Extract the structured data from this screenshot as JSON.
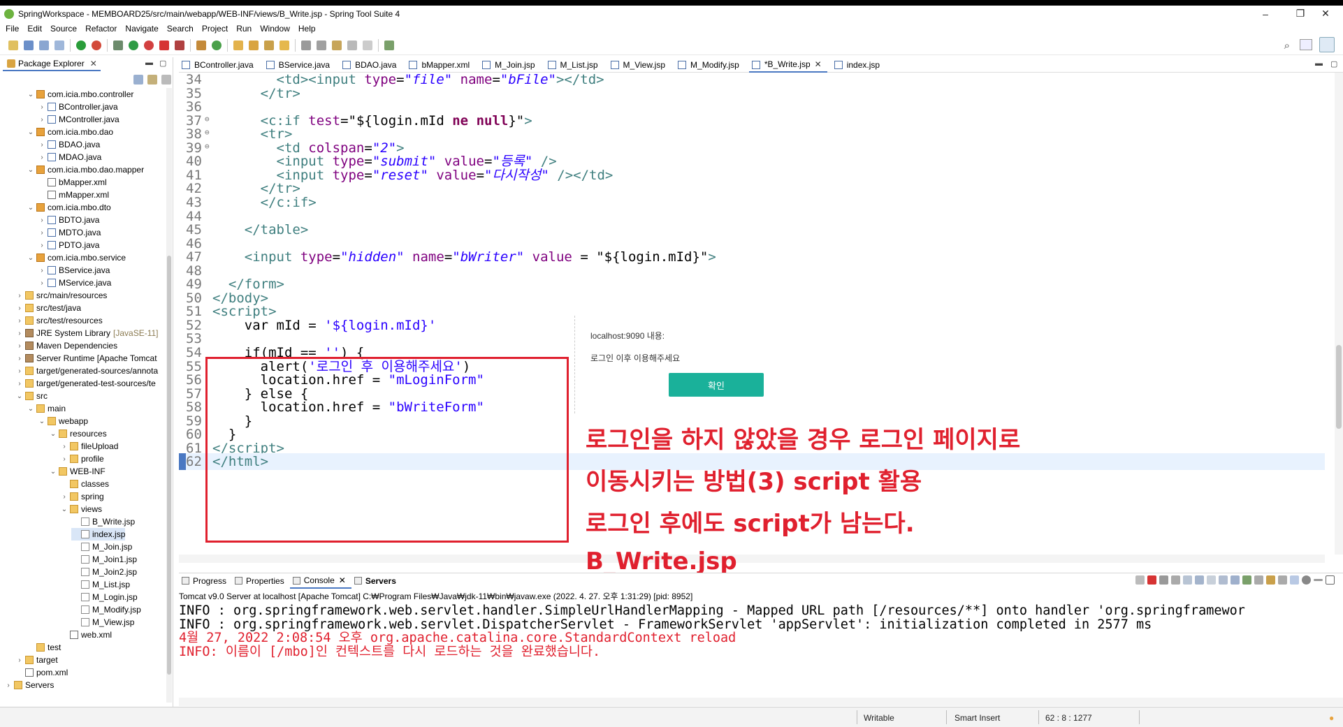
{
  "window": {
    "title": "SpringWorkspace - MEMBOARD25/src/main/webapp/WEB-INF/views/B_Write.jsp - Spring Tool Suite 4",
    "minimize": "–",
    "maximize": "❐",
    "close": "✕"
  },
  "menu": [
    "File",
    "Edit",
    "Source",
    "Refactor",
    "Navigate",
    "Search",
    "Project",
    "Run",
    "Window",
    "Help"
  ],
  "package_explorer": {
    "title": "Package Explorer",
    "close": "✕",
    "tree": [
      {
        "label": "com.icia.mbo.controller",
        "indent": 3,
        "arrow": "v",
        "icon": "pkg"
      },
      {
        "label": "BController.java",
        "indent": 4,
        "arrow": ">",
        "icon": "java"
      },
      {
        "label": "MController.java",
        "indent": 4,
        "arrow": ">",
        "icon": "java"
      },
      {
        "label": "com.icia.mbo.dao",
        "indent": 3,
        "arrow": "v",
        "icon": "pkg"
      },
      {
        "label": "BDAO.java",
        "indent": 4,
        "arrow": ">",
        "icon": "java"
      },
      {
        "label": "MDAO.java",
        "indent": 4,
        "arrow": ">",
        "icon": "java"
      },
      {
        "label": "com.icia.mbo.dao.mapper",
        "indent": 3,
        "arrow": "v",
        "icon": "pkg"
      },
      {
        "label": "bMapper.xml",
        "indent": 4,
        "arrow": "",
        "icon": "xml"
      },
      {
        "label": "mMapper.xml",
        "indent": 4,
        "arrow": "",
        "icon": "xml"
      },
      {
        "label": "com.icia.mbo.dto",
        "indent": 3,
        "arrow": "v",
        "icon": "pkg"
      },
      {
        "label": "BDTO.java",
        "indent": 4,
        "arrow": ">",
        "icon": "java"
      },
      {
        "label": "MDTO.java",
        "indent": 4,
        "arrow": ">",
        "icon": "java"
      },
      {
        "label": "PDTO.java",
        "indent": 4,
        "arrow": ">",
        "icon": "java"
      },
      {
        "label": "com.icia.mbo.service",
        "indent": 3,
        "arrow": "v",
        "icon": "pkg"
      },
      {
        "label": "BService.java",
        "indent": 4,
        "arrow": ">",
        "icon": "java"
      },
      {
        "label": "MService.java",
        "indent": 4,
        "arrow": ">",
        "icon": "java"
      },
      {
        "label": "src/main/resources",
        "indent": 2,
        "arrow": ">",
        "icon": "folder"
      },
      {
        "label": "src/test/java",
        "indent": 2,
        "arrow": ">",
        "icon": "folder"
      },
      {
        "label": "src/test/resources",
        "indent": 2,
        "arrow": ">",
        "icon": "folder"
      },
      {
        "label": "JRE System Library",
        "suffix": "[JavaSE-11]",
        "indent": 2,
        "arrow": ">",
        "icon": "lib"
      },
      {
        "label": "Maven Dependencies",
        "indent": 2,
        "arrow": ">",
        "icon": "lib"
      },
      {
        "label": "Server Runtime [Apache Tomcat",
        "indent": 2,
        "arrow": ">",
        "icon": "lib"
      },
      {
        "label": "target/generated-sources/annota",
        "indent": 2,
        "arrow": ">",
        "icon": "folder"
      },
      {
        "label": "target/generated-test-sources/te",
        "indent": 2,
        "arrow": ">",
        "icon": "folder"
      },
      {
        "label": "src",
        "indent": 2,
        "arrow": "v",
        "icon": "folder"
      },
      {
        "label": "main",
        "indent": 3,
        "arrow": "v",
        "icon": "folder"
      },
      {
        "label": "webapp",
        "indent": 4,
        "arrow": "v",
        "icon": "folder"
      },
      {
        "label": "resources",
        "indent": 5,
        "arrow": "v",
        "icon": "folder"
      },
      {
        "label": "fileUpload",
        "indent": 6,
        "arrow": ">",
        "icon": "folder"
      },
      {
        "label": "profile",
        "indent": 6,
        "arrow": ">",
        "icon": "folder"
      },
      {
        "label": "WEB-INF",
        "indent": 5,
        "arrow": "v",
        "icon": "folder"
      },
      {
        "label": "classes",
        "indent": 6,
        "arrow": "",
        "icon": "folder"
      },
      {
        "label": "spring",
        "indent": 6,
        "arrow": ">",
        "icon": "folder"
      },
      {
        "label": "views",
        "indent": 6,
        "arrow": "v",
        "icon": "folder"
      },
      {
        "label": "B_Write.jsp",
        "indent": 7,
        "arrow": "",
        "icon": "jsp"
      },
      {
        "label": "index.jsp",
        "indent": 7,
        "arrow": "",
        "icon": "jsp",
        "selected": true
      },
      {
        "label": "M_Join.jsp",
        "indent": 7,
        "arrow": "",
        "icon": "jsp"
      },
      {
        "label": "M_Join1.jsp",
        "indent": 7,
        "arrow": "",
        "icon": "jsp"
      },
      {
        "label": "M_Join2.jsp",
        "indent": 7,
        "arrow": "",
        "icon": "jsp"
      },
      {
        "label": "M_List.jsp",
        "indent": 7,
        "arrow": "",
        "icon": "jsp"
      },
      {
        "label": "M_Login.jsp",
        "indent": 7,
        "arrow": "",
        "icon": "jsp"
      },
      {
        "label": "M_Modify.jsp",
        "indent": 7,
        "arrow": "",
        "icon": "jsp"
      },
      {
        "label": "M_View.jsp",
        "indent": 7,
        "arrow": "",
        "icon": "jsp"
      },
      {
        "label": "web.xml",
        "indent": 6,
        "arrow": "",
        "icon": "xml"
      },
      {
        "label": "test",
        "indent": 3,
        "arrow": "",
        "icon": "folder"
      },
      {
        "label": "target",
        "indent": 2,
        "arrow": ">",
        "icon": "folder"
      },
      {
        "label": "pom.xml",
        "indent": 2,
        "arrow": "",
        "icon": "xml"
      },
      {
        "label": "Servers",
        "indent": 1,
        "arrow": ">",
        "icon": "folder"
      }
    ]
  },
  "editor": {
    "tabs": [
      {
        "label": "BController.java"
      },
      {
        "label": "BService.java"
      },
      {
        "label": "BDAO.java"
      },
      {
        "label": "bMapper.xml"
      },
      {
        "label": "M_Join.jsp"
      },
      {
        "label": "M_List.jsp"
      },
      {
        "label": "M_View.jsp"
      },
      {
        "label": "M_Modify.jsp"
      },
      {
        "label": "*B_Write.jsp",
        "active": true,
        "close": "✕"
      },
      {
        "label": "index.jsp"
      }
    ],
    "lines": [
      {
        "n": "34",
        "html": "        <span class='tg'>&lt;td&gt;&lt;input</span> <span class='at'>type</span>=<span class='sv'>\"file\"</span> <span class='at'>name</span>=<span class='sv'>\"bFile\"</span><span class='tg'>&gt;&lt;/td&gt;</span>"
      },
      {
        "n": "35",
        "html": "      <span class='tg'>&lt;/tr&gt;</span>"
      },
      {
        "n": "36",
        "html": ""
      },
      {
        "n": "37",
        "mark": "⊖",
        "html": "      <span class='tg'>&lt;c:if</span> <span class='at'>test</span>=\"${login.mId <span class='kw'>ne</span> <span class='kw'>null</span>}\"<span class='tg'>&gt;</span>"
      },
      {
        "n": "38",
        "mark": "⊖",
        "html": "      <span class='tg'>&lt;tr&gt;</span>"
      },
      {
        "n": "39",
        "mark": "⊖",
        "html": "        <span class='tg'>&lt;td</span> <span class='at'>colspan</span>=<span class='sv'>\"2\"</span><span class='tg'>&gt;</span>"
      },
      {
        "n": "40",
        "html": "        <span class='tg'>&lt;input</span> <span class='at'>type</span>=<span class='sv'>\"submit\"</span> <span class='at'>value</span>=<span class='sv'>\"등록\"</span> <span class='tg'>/&gt;</span>"
      },
      {
        "n": "41",
        "html": "        <span class='tg'>&lt;input</span> <span class='at'>type</span>=<span class='sv'>\"reset\"</span> <span class='at'>value</span>=<span class='sv'>\"다시작성\"</span> <span class='tg'>/&gt;&lt;/td&gt;</span>"
      },
      {
        "n": "42",
        "html": "      <span class='tg'>&lt;/tr&gt;</span>"
      },
      {
        "n": "43",
        "html": "      <span class='tg'>&lt;/c:if&gt;</span>"
      },
      {
        "n": "44",
        "html": ""
      },
      {
        "n": "45",
        "html": "    <span class='tg'>&lt;/table&gt;</span>"
      },
      {
        "n": "46",
        "html": ""
      },
      {
        "n": "47",
        "html": "    <span class='tg'>&lt;input</span> <span class='at'>type</span>=<span class='sv'>\"hidden\"</span> <span class='at'>name</span>=<span class='sv'>\"bWriter\"</span> <span class='at'>value</span> = \"${login.mId}\"<span class='tg'>&gt;</span>"
      },
      {
        "n": "48",
        "html": ""
      },
      {
        "n": "49",
        "html": "  <span class='tg'>&lt;/form&gt;</span>"
      },
      {
        "n": "50",
        "html": "<span class='tg'>&lt;/body&gt;</span>"
      },
      {
        "n": "51",
        "html": "<span class='tg'>&lt;script&gt;</span>"
      },
      {
        "n": "52",
        "html": "    <span class='el'>var mId = </span><span class='str'>'${login.mId}'</span>"
      },
      {
        "n": "53",
        "html": ""
      },
      {
        "n": "54",
        "html": "    <span class='el'>if(mId == </span><span class='str'>''</span><span class='el'>) {</span>"
      },
      {
        "n": "55",
        "html": "      <span class='el'>alert(</span><span class='str'>'로그인 후 이용해주세요'</span><span class='el'>)</span>"
      },
      {
        "n": "56",
        "html": "      <span class='el'>location.href = </span><span class='str'>\"mLoginForm\"</span>"
      },
      {
        "n": "57",
        "html": "    <span class='el'>} else {</span>"
      },
      {
        "n": "58",
        "html": "      <span class='el'>location.href = </span><span class='str'>\"bWriteForm\"</span>"
      },
      {
        "n": "59",
        "html": "    <span class='el'>}</span>"
      },
      {
        "n": "60",
        "html": "  <span class='el'>}</span>"
      },
      {
        "n": "61",
        "html": "<span class='tg'>&lt;/script&gt;</span>"
      },
      {
        "n": "62",
        "html": "<span class='tg'>&lt;/html&gt;</span>",
        "current": true
      }
    ]
  },
  "alert_dialog": {
    "host": "localhost:9090 내용:",
    "message": "로그인 이후 이용해주세요",
    "ok_label": "확인"
  },
  "annotations": [
    "로그인을 하지 않았을 경우 로그인 페이지로",
    "이동시키는 방법(3) script 활용",
    "로그인 후에도 script가 남는다.",
    "B_Write.jsp"
  ],
  "console": {
    "tabs": [
      {
        "label": "Progress"
      },
      {
        "label": "Properties"
      },
      {
        "label": "Console",
        "active": true,
        "close": "✕"
      },
      {
        "label": "Servers",
        "bold": true
      }
    ],
    "description": "Tomcat v9.0 Server at localhost [Apache Tomcat] C:₩Program Files₩Java₩jdk-11₩bin₩javaw.exe  (2022. 4. 27. 오후 1:31:29) [pid: 8952]",
    "lines": [
      {
        "text": "INFO : org.springframework.web.servlet.handler.SimpleUrlHandlerMapping - Mapped URL path [/resources/**] onto handler 'org.springframewor",
        "red": false
      },
      {
        "text": "INFO : org.springframework.web.servlet.DispatcherServlet - FrameworkServlet 'appServlet': initialization completed in 2577 ms",
        "red": false
      },
      {
        "text": "4월 27, 2022 2:08:54 오후 org.apache.catalina.core.StandardContext reload",
        "red": true
      },
      {
        "text": "INFO: 이름이 [/mbo]인 컨텍스트를 다시 로드하는 것을 완료했습니다.",
        "red": true
      }
    ]
  },
  "status": {
    "writable": "Writable",
    "insert": "Smart Insert",
    "position": "62 : 8 : 1277"
  },
  "colors": {
    "accent": "#4a78c2",
    "annotation_red": "#e0202e",
    "ok_button": "#1ab19a"
  }
}
